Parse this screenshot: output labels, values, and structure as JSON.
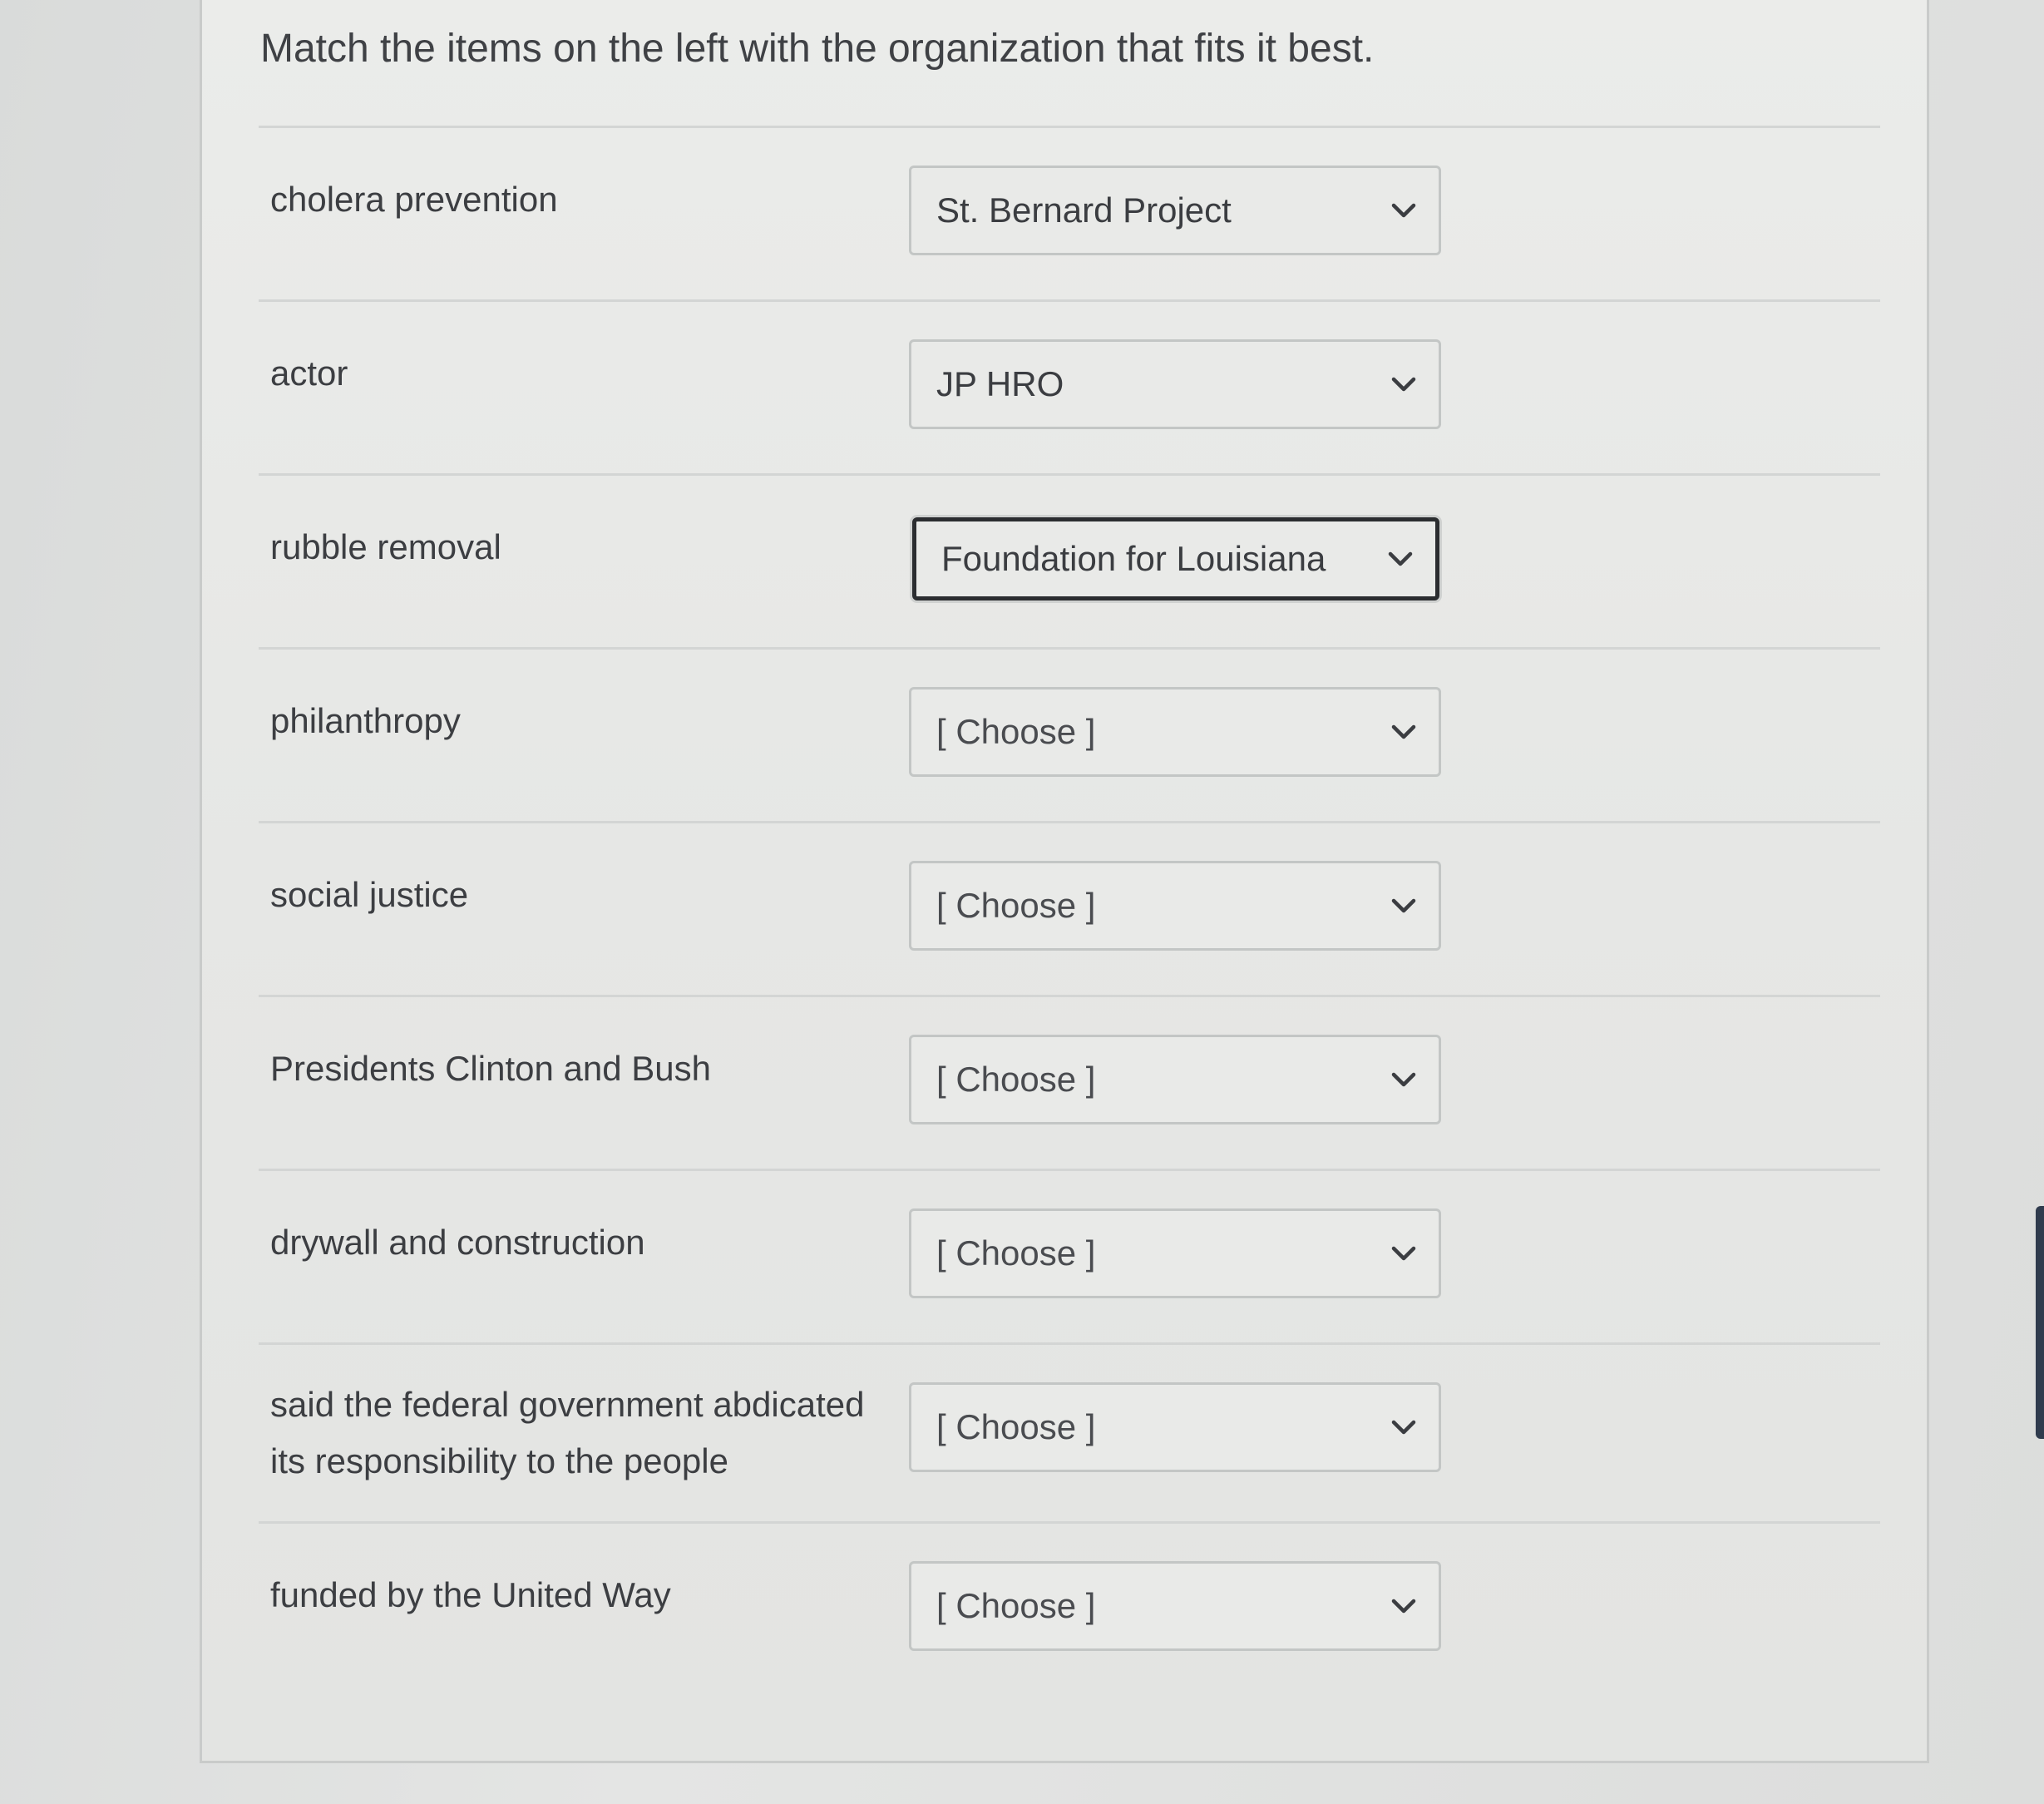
{
  "question": {
    "text": "Match the items on the left with the organization that fits it best."
  },
  "rows": [
    {
      "item": "cholera prevention",
      "selected": "St. Bernard Project",
      "placeholder": false
    },
    {
      "item": "actor",
      "selected": "JP HRO",
      "placeholder": false
    },
    {
      "item": "rubble removal",
      "selected": "Foundation for Louisiana",
      "placeholder": false
    },
    {
      "item": "philanthropy",
      "selected": "[ Choose ]",
      "placeholder": true
    },
    {
      "item": "social justice",
      "selected": "[ Choose ]",
      "placeholder": true
    },
    {
      "item": "Presidents Clinton and Bush",
      "selected": "[ Choose ]",
      "placeholder": true
    },
    {
      "item": "drywall and construction",
      "selected": "[ Choose ]",
      "placeholder": true
    },
    {
      "item": "said the federal government abdicated its responsibility to the people",
      "selected": "[ Choose ]",
      "placeholder": true
    },
    {
      "item": "funded by the United Way",
      "selected": "[ Choose ]",
      "placeholder": true
    }
  ],
  "icons": {
    "dropdown": "chevron-down-icon"
  },
  "colors": {
    "background": "#dcdedd",
    "card": "#e8e9e7",
    "text": "#3d3f42",
    "focus_border": "#2b2d30"
  }
}
